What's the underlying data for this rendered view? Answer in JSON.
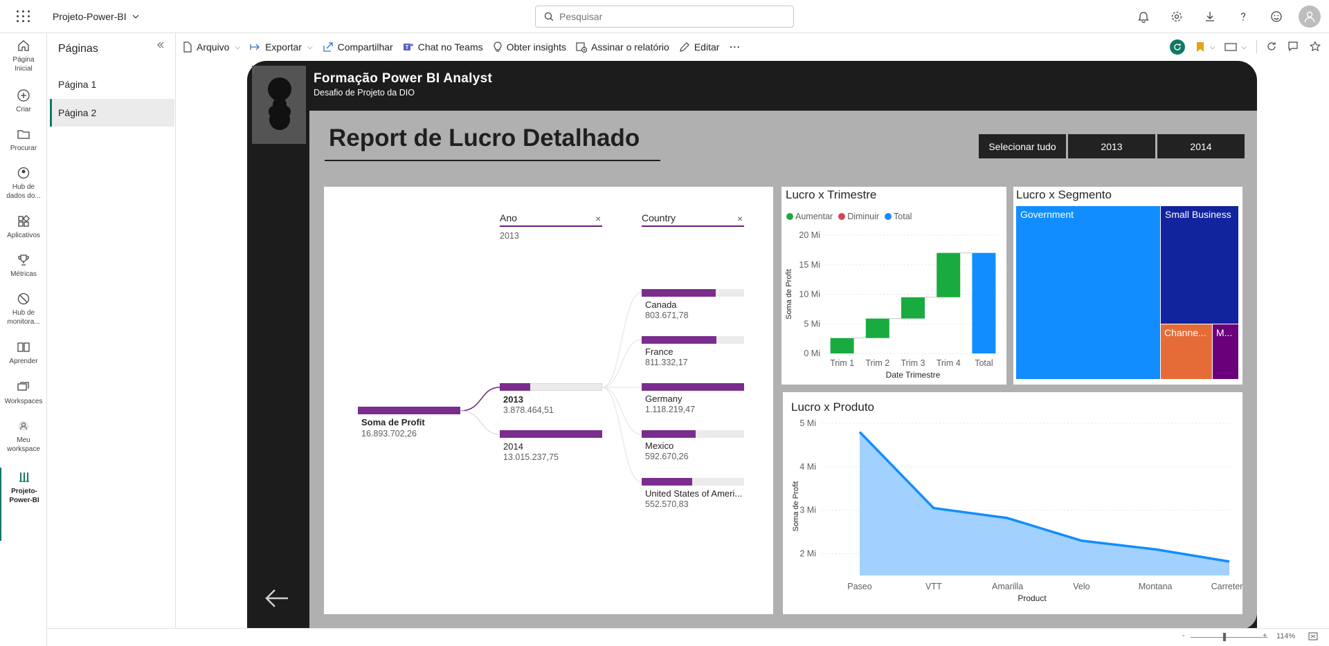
{
  "topbar": {
    "workspace_name": "Projeto-Power-BI",
    "search_placeholder": "Pesquisar"
  },
  "leftnav": {
    "items": [
      {
        "label": "Página Inicial",
        "icon": "home-icon"
      },
      {
        "label": "Criar",
        "icon": "plus-circle-icon"
      },
      {
        "label": "Procurar",
        "icon": "folder-icon"
      },
      {
        "label": "Hub de dados do...",
        "icon": "data-hub-icon"
      },
      {
        "label": "Aplicativos",
        "icon": "apps-icon"
      },
      {
        "label": "Métricas",
        "icon": "trophy-icon"
      },
      {
        "label": "Hub de monitora...",
        "icon": "monitor-hub-icon"
      },
      {
        "label": "Aprender",
        "icon": "book-icon"
      },
      {
        "label": "Workspaces",
        "icon": "workspaces-icon"
      },
      {
        "label": "Meu workspace",
        "icon": "user-workspace-icon"
      },
      {
        "label": "Projeto-Power-BI",
        "icon": "report-icon"
      }
    ]
  },
  "pages_panel": {
    "title": "Páginas",
    "pages": [
      "Página 1",
      "Página 2"
    ],
    "selected": "Página 2"
  },
  "toolbar": {
    "file": "Arquivo",
    "export": "Exportar",
    "share": "Compartilhar",
    "teams": "Chat no Teams",
    "insights": "Obter insights",
    "subscribe": "Assinar o relatório",
    "edit": "Editar",
    "more": "⋯"
  },
  "report": {
    "header_title": "Formação Power BI Analyst",
    "header_subtitle": "Desafio de Projeto da DIO",
    "title": "Report de Lucro Detalhado",
    "slicer": [
      "Selecionar tudo",
      "2013",
      "2014"
    ]
  },
  "decomp_tree": {
    "level1_header": "Ano",
    "level1_filter": "2013",
    "level2_header": "Country",
    "root": {
      "label": "Soma de Profit",
      "value": "16.893.702,26"
    },
    "years": [
      {
        "label": "2013",
        "value": "3.878.464,51",
        "fill": 0.3
      },
      {
        "label": "2014",
        "value": "13.015.237,75",
        "fill": 1.0
      }
    ],
    "countries": [
      {
        "label": "Canada",
        "value": "803.671,78",
        "fill": 0.72
      },
      {
        "label": "France",
        "value": "811.332,17",
        "fill": 0.73
      },
      {
        "label": "Germany",
        "value": "1.118.219,47",
        "fill": 1.0
      },
      {
        "label": "Mexico",
        "value": "592.670,26",
        "fill": 0.53
      },
      {
        "label": "United States of Ameri...",
        "value": "552.570,83",
        "fill": 0.49
      }
    ]
  },
  "chart_data": [
    {
      "type": "waterfall",
      "title": "Lucro x Trimestre",
      "legend": [
        "Aumentar",
        "Diminuir",
        "Total"
      ],
      "colors": {
        "increase": "#1aab40",
        "decrease": "#d64554",
        "total": "#118dff"
      },
      "categories": [
        "Trim 1",
        "Trim 2",
        "Trim 3",
        "Trim 4",
        "Total"
      ],
      "values": [
        2.6,
        3.3,
        3.6,
        7.5,
        17.0
      ],
      "xlabel": "Date Trimestre",
      "ylabel": "Soma de Profit",
      "yticks": [
        "0 Mi",
        "5 Mi",
        "10 Mi",
        "15 Mi",
        "20 Mi"
      ],
      "ylim": [
        0,
        20
      ]
    },
    {
      "type": "treemap",
      "title": "Lucro x Segmento",
      "items": [
        {
          "label": "Government",
          "color": "#118dff"
        },
        {
          "label": "Small Business",
          "color": "#12239e"
        },
        {
          "label": "Channe...",
          "color": "#e66c37"
        },
        {
          "label": "M...",
          "color": "#6b007b"
        }
      ]
    },
    {
      "type": "area",
      "title": "Lucro x Produto",
      "categories": [
        "Paseo",
        "VTT",
        "Amarilla",
        "Velo",
        "Montana",
        "Carretera"
      ],
      "values": [
        4.8,
        3.05,
        2.82,
        2.3,
        2.1,
        1.82
      ],
      "xlabel": "Product",
      "ylabel": "Soma de Profit",
      "yticks": [
        "2 Mi",
        "3 Mi",
        "4 Mi",
        "5 Mi"
      ],
      "ylim": [
        1.5,
        5
      ],
      "color": "#118dff"
    }
  ],
  "statusbar": {
    "zoom": "114%",
    "zoom_minus": "-",
    "zoom_plus": "+"
  }
}
